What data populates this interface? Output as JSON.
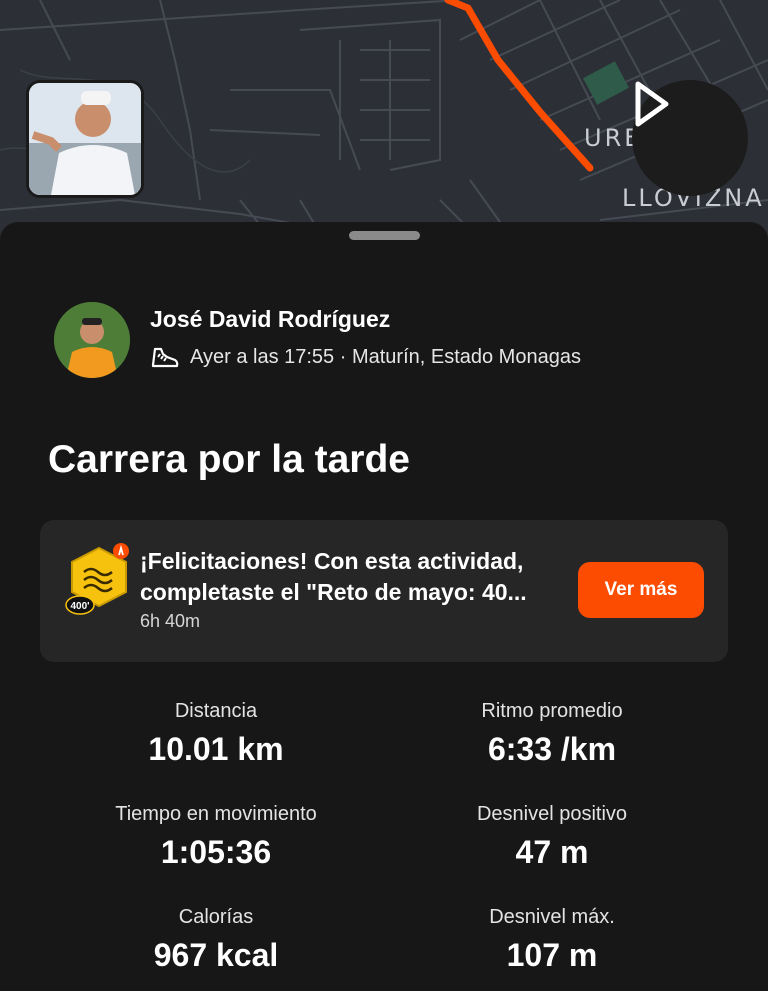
{
  "map": {
    "labels": [
      "URE",
      "LLOVIZNA"
    ]
  },
  "athlete": {
    "name": "José David Rodríguez",
    "meta": "Ayer a las 17:55 · Maturín, Estado Monagas"
  },
  "activity": {
    "title": "Carrera por la tarde"
  },
  "challenge": {
    "badge_text": "400'",
    "line1": "¡Felicitaciones! Con esta actividad,",
    "line2": "completaste el \"Reto de mayo: 40...",
    "time": "6h 40m",
    "button_label": "Ver más"
  },
  "stats": [
    {
      "label": "Distancia",
      "value": "10.01 km"
    },
    {
      "label": "Ritmo promedio",
      "value": "6:33 /km"
    },
    {
      "label": "Tiempo en movimiento",
      "value": "1:05:36"
    },
    {
      "label": "Desnivel positivo",
      "value": "47 m"
    },
    {
      "label": "Calorías",
      "value": "967 kcal"
    },
    {
      "label": "Desnivel máx.",
      "value": "107 m"
    }
  ],
  "colors": {
    "accent": "#fc4c02",
    "background": "#171717",
    "card": "#262626",
    "map": "#2c2f36"
  }
}
